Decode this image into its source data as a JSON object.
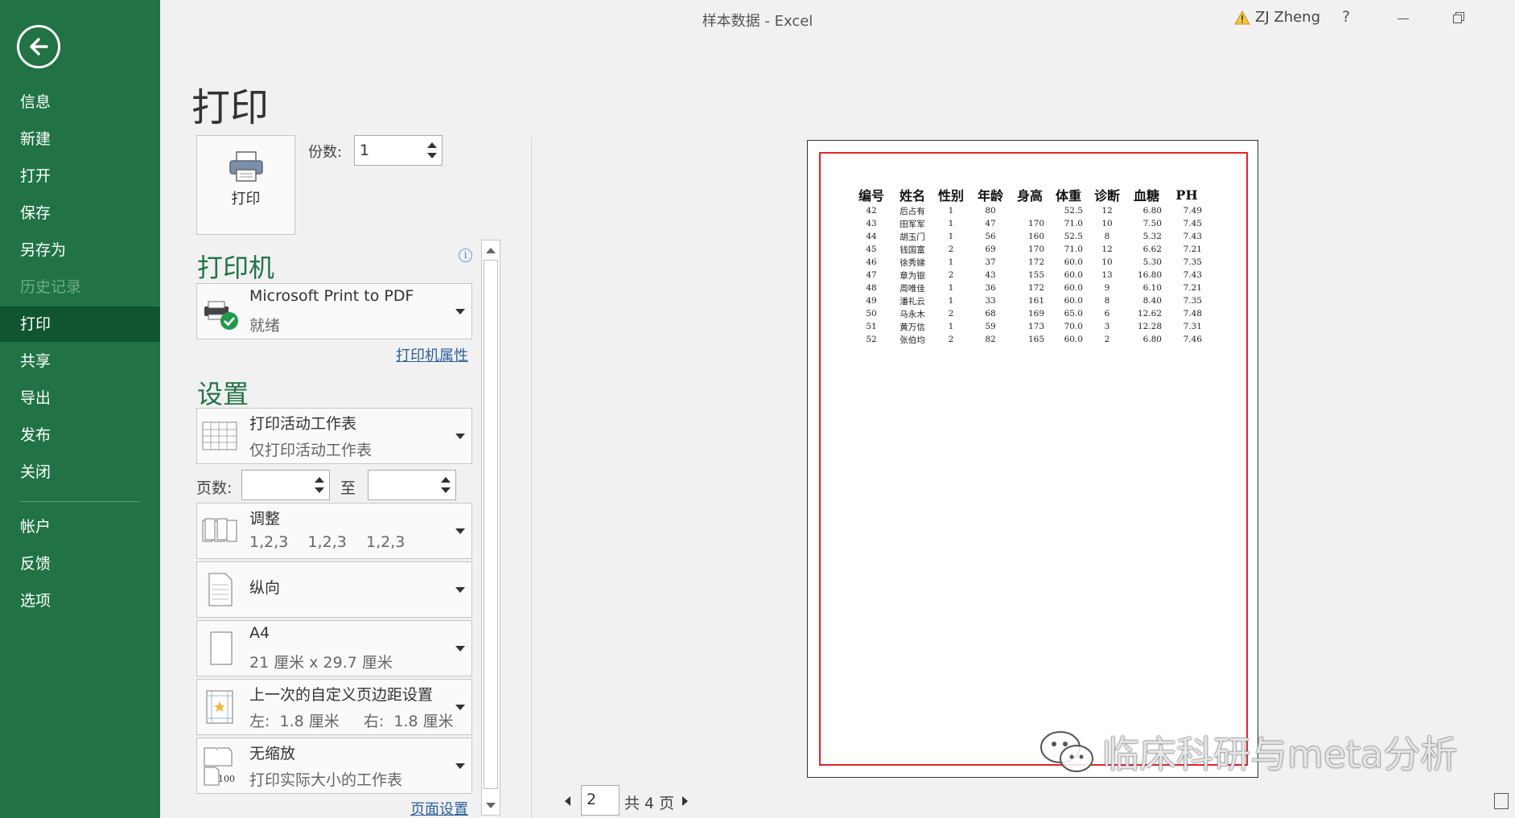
{
  "window": {
    "title": "样本数据 - Excel",
    "user": "ZJ Zheng",
    "help": "?"
  },
  "sidebar": {
    "items": [
      {
        "label": "信息",
        "state": "normal"
      },
      {
        "label": "新建",
        "state": "normal"
      },
      {
        "label": "打开",
        "state": "normal"
      },
      {
        "label": "保存",
        "state": "normal"
      },
      {
        "label": "另存为",
        "state": "normal"
      },
      {
        "label": "历史记录",
        "state": "disabled"
      },
      {
        "label": "打印",
        "state": "active"
      },
      {
        "label": "共享",
        "state": "normal"
      },
      {
        "label": "导出",
        "state": "normal"
      },
      {
        "label": "发布",
        "state": "normal"
      },
      {
        "label": "关闭",
        "state": "normal"
      },
      {
        "label": "帐户",
        "state": "normal"
      },
      {
        "label": "反馈",
        "state": "normal"
      },
      {
        "label": "选项",
        "state": "normal"
      }
    ]
  },
  "print": {
    "title": "打印",
    "button_label": "打印",
    "copies_label": "份数:",
    "copies_value": "1",
    "printer_heading": "打印机",
    "printer_name": "Microsoft Print to PDF",
    "printer_status": "就绪",
    "printer_properties": "打印机属性",
    "settings_heading": "设置",
    "what": {
      "l1": "打印活动工作表",
      "l2": "仅打印活动工作表"
    },
    "pages_label": "页数:",
    "pages_to": "至",
    "collate": {
      "l1": "调整",
      "l2": "1,2,3    1,2,3    1,2,3"
    },
    "orientation": {
      "l1": "纵向"
    },
    "paper": {
      "l1": "A4",
      "l2": "21 厘米 x 29.7 厘米"
    },
    "margins": {
      "l1": "上一次的自定义页边距设置",
      "l2": "左:  1.8 厘米     右:  1.8 厘米"
    },
    "scaling": {
      "l1": "无缩放",
      "l2": "打印实际大小的工作表",
      "icon_num": "100"
    },
    "page_setup": "页面设置"
  },
  "pager": {
    "current": "2",
    "total": "共 4 页"
  },
  "watermark": "临床科研与meta分析",
  "sheet": {
    "headers": [
      "编号",
      "姓名",
      "性别",
      "年龄",
      "身高",
      "体重",
      "诊断",
      "血糖",
      "PH"
    ],
    "rows": [
      [
        "42",
        "后占有",
        "1",
        "80",
        "",
        "52.5",
        "12",
        "6.80",
        "7.49"
      ],
      [
        "43",
        "田军军",
        "1",
        "47",
        "170",
        "71.0",
        "10",
        "7.50",
        "7.45"
      ],
      [
        "44",
        "胡玉门",
        "1",
        "56",
        "160",
        "52.5",
        "8",
        "5.32",
        "7.43"
      ],
      [
        "45",
        "钱国富",
        "2",
        "69",
        "170",
        "71.0",
        "12",
        "6.62",
        "7.21"
      ],
      [
        "46",
        "徐秀娣",
        "1",
        "37",
        "172",
        "60.0",
        "10",
        "5.30",
        "7.35"
      ],
      [
        "47",
        "章为银",
        "2",
        "43",
        "155",
        "60.0",
        "13",
        "16.80",
        "7.43"
      ],
      [
        "48",
        "周唯佳",
        "1",
        "36",
        "172",
        "60.0",
        "9",
        "6.10",
        "7.21"
      ],
      [
        "49",
        "潘礼云",
        "1",
        "33",
        "161",
        "60.0",
        "8",
        "8.40",
        "7.35"
      ],
      [
        "50",
        "马永木",
        "2",
        "68",
        "169",
        "65.0",
        "6",
        "12.62",
        "7.48"
      ],
      [
        "51",
        "黄万信",
        "1",
        "59",
        "173",
        "70.0",
        "3",
        "12.28",
        "7.31"
      ],
      [
        "52",
        "张伯均",
        "2",
        "82",
        "165",
        "60.0",
        "2",
        "6.80",
        "7.46"
      ]
    ]
  },
  "colors": {
    "sidebar": "#217346",
    "sidebar_active": "#0f5530",
    "accent": "#217346",
    "margin_line": "#e0242c",
    "link": "#2b5f9e"
  }
}
